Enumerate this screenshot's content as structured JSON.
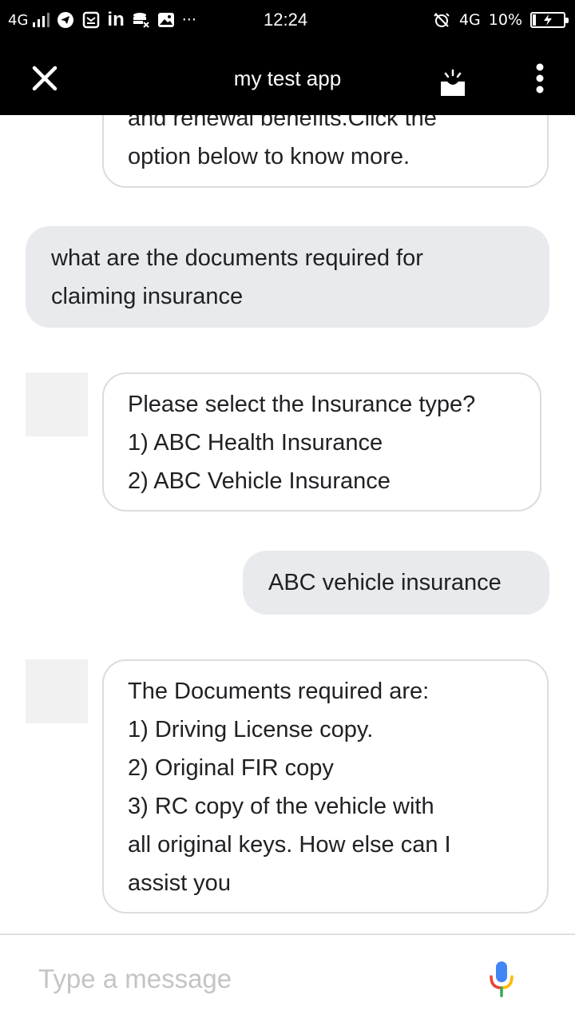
{
  "status_bar": {
    "network_left": "4G",
    "linkedin": "in",
    "more": "···",
    "time": "12:24",
    "network_right": "4G",
    "battery": "10%",
    "battery_level": 0.1
  },
  "app_bar": {
    "title": "my test app"
  },
  "messages": [
    {
      "from": "bot",
      "lines": [
        "and renewal benefits.Click the",
        "option below to know more."
      ]
    },
    {
      "from": "user",
      "lines": [
        "what are the documents required for",
        "claiming insurance"
      ]
    },
    {
      "from": "bot",
      "lines": [
        "Please select the Insurance type?",
        "1) ABC Health Insurance",
        "2) ABC Vehicle Insurance"
      ]
    },
    {
      "from": "user",
      "lines": [
        "ABC vehicle insurance"
      ]
    },
    {
      "from": "bot",
      "lines": [
        "The Documents required are:",
        "1) Driving License copy.",
        "2) Original FIR copy",
        "3) RC copy of the vehicle with",
        "all original keys. How else can I",
        "assist you"
      ]
    }
  ],
  "composer": {
    "placeholder": "Type a message",
    "value": ""
  },
  "colors": {
    "bar_background": "#000000",
    "user_bubble": "#e8eaed",
    "bot_border": "#dadce0",
    "mic_blue": "#4285f4",
    "mic_red": "#ea4335",
    "mic_yellow": "#fbbc04",
    "mic_green": "#34a853"
  },
  "icons": {
    "close": "close-icon",
    "tray": "inbox-tray-icon",
    "more": "more-vert-icon",
    "mic": "microphone-icon"
  }
}
